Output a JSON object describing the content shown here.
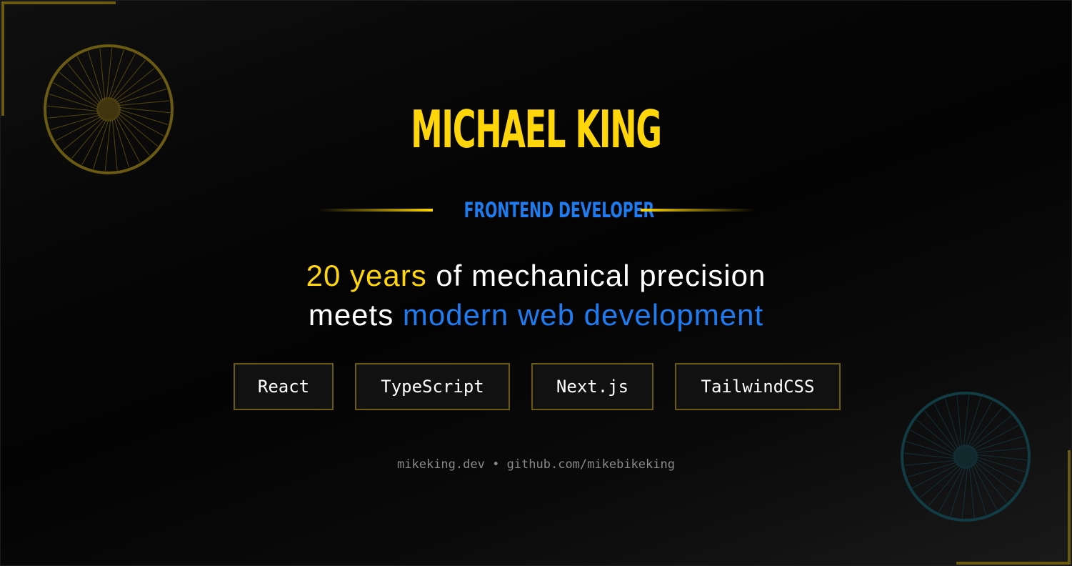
{
  "profile": {
    "name": "MICHAEL KING",
    "role": "FRONTEND DEVELOPER"
  },
  "tagline": {
    "line1_highlight": "20 years",
    "line1_rest": " of mechanical precision",
    "line2_start": "meets ",
    "line2_highlight": "modern web development"
  },
  "skills": [
    "React",
    "TypeScript",
    "Next.js",
    "TailwindCSS"
  ],
  "footer": {
    "website": "mikeking.dev",
    "separator": " • ",
    "github": "github.com/mikebikeking"
  },
  "decorations": {
    "top_left": "bicycle-wheel-icon",
    "bottom_right": "bicycle-wheel-icon"
  },
  "colors": {
    "accent_yellow": "#ffd60a",
    "accent_blue": "#1e7cf0",
    "wheel_gold": "#6b5a12",
    "wheel_teal": "#123c44",
    "background": "#050505"
  }
}
